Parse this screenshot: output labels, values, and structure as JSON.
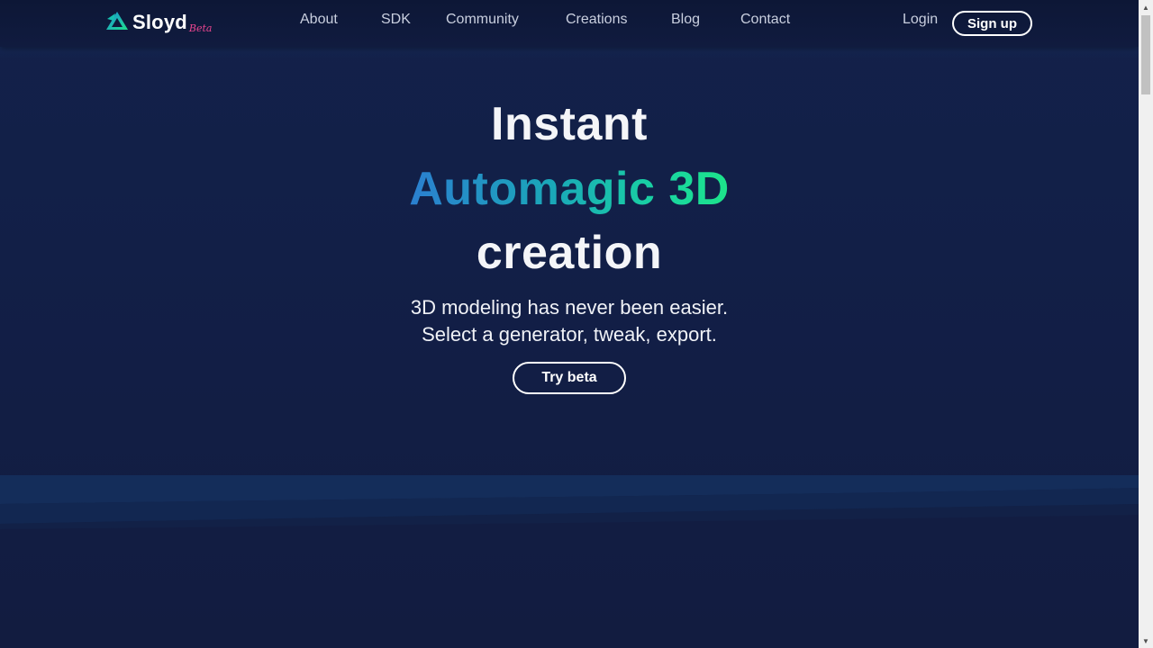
{
  "brand": {
    "name": "Sloyd",
    "badge": "Beta"
  },
  "nav": {
    "items": [
      {
        "label": "About"
      },
      {
        "label": "SDK"
      },
      {
        "label": "Community"
      },
      {
        "label": "Creations"
      },
      {
        "label": "Blog"
      },
      {
        "label": "Contact"
      }
    ],
    "login_label": "Login",
    "signup_label": "Sign up"
  },
  "hero": {
    "line1": "Instant",
    "line2": "Automagic 3D",
    "line3": "creation",
    "subtitle_line1": "3D modeling has never been easier.",
    "subtitle_line2": "Select a generator, tweak, export.",
    "cta_label": "Try beta"
  },
  "colors": {
    "background": "#121c3f",
    "header": "#0d1736",
    "gradient_start": "#2b7fd0",
    "gradient_end": "#1de38a",
    "beta_badge": "#e8458f"
  },
  "icons": {
    "logo": "sloyd-logo-icon",
    "scroll_up": "scroll-up-arrow-icon",
    "scroll_down": "scroll-down-arrow-icon"
  }
}
